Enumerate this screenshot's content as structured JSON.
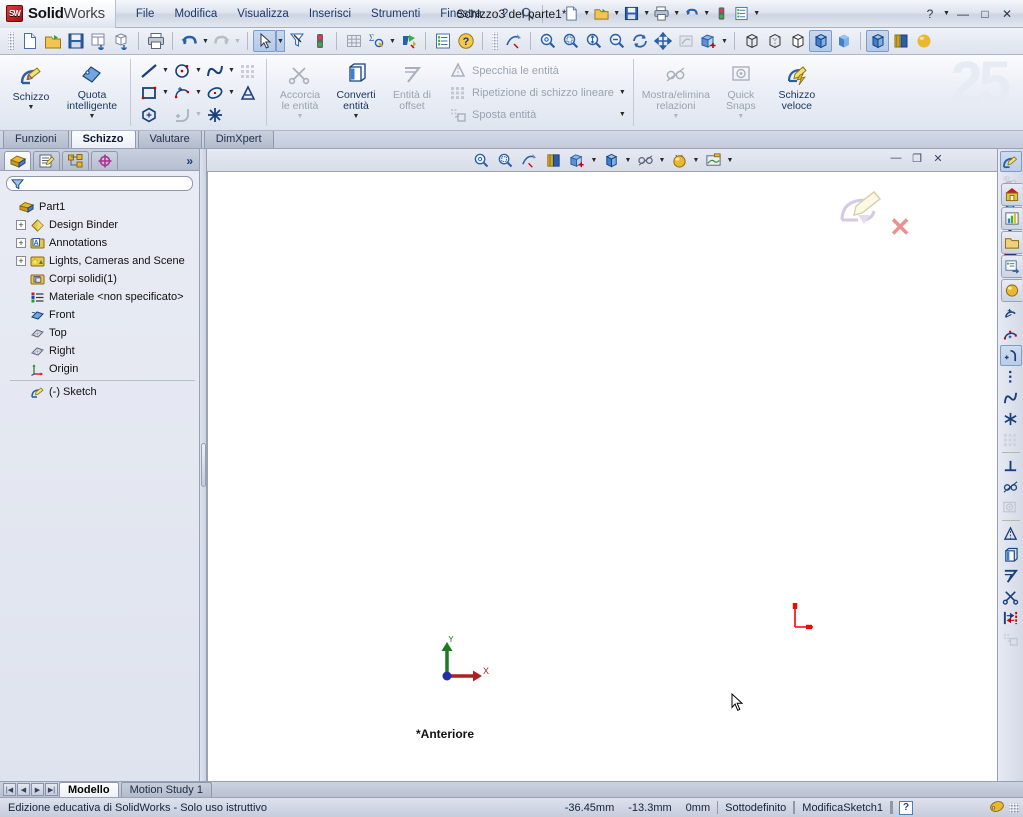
{
  "app": {
    "brand_bold": "Solid",
    "brand_light": "Works",
    "logo_text": "SW",
    "document_title": "Schizzo3 del parte1*"
  },
  "menu": {
    "items": [
      {
        "label": "File",
        "name": "menu-file"
      },
      {
        "label": "Modifica",
        "name": "menu-modifica"
      },
      {
        "label": "Visualizza",
        "name": "menu-visualizza"
      },
      {
        "label": "Inserisci",
        "name": "menu-inserisci"
      },
      {
        "label": "Strumenti",
        "name": "menu-strumenti"
      },
      {
        "label": "Finestra",
        "name": "menu-finestra"
      },
      {
        "label": "?",
        "name": "menu-help"
      }
    ]
  },
  "quick_access": {
    "icons": [
      "new-document-icon",
      "open-folder-icon",
      "save-icon",
      "print-icon",
      "undo-icon",
      "rebuild-icon",
      "options-icon"
    ]
  },
  "window_controls": {
    "help": "?",
    "minimize": "—",
    "maximize": "□",
    "close": "✕"
  },
  "standard_toolbar": {
    "icons": [
      "new-document-icon",
      "open-folder-icon",
      "save-icon",
      "save-all-icon",
      "pack-and-go-icon",
      "print-icon",
      "undo-icon",
      "redo-icon",
      "select-icon",
      "select-filter-icon",
      "rebuild-icon",
      "section-view-grid-icon",
      "measure-icon",
      "mass-properties-icon",
      "options-icon",
      "help-icon",
      "shaded-sketch-icon",
      "zoom-fit-icon",
      "zoom-area-icon",
      "zoom-in-out-icon",
      "zoom-selection-icon",
      "rotate-view-icon",
      "pan-icon",
      "3d-drawing-view-icon",
      "view-orientation-icon",
      "wireframe-icon",
      "hidden-lines-visible-icon",
      "hidden-lines-removed-icon",
      "shaded-with-edges-icon",
      "shaded-icon",
      "display-style-icon",
      "section-view-icon",
      "appearance-icon"
    ]
  },
  "ribbon": {
    "groups": [
      {
        "name": "sketch-group",
        "buttons": [
          {
            "label": "Schizzo",
            "icon": "sketch-pencil-icon",
            "disabled": false,
            "has_caret": true,
            "name": "ribbon-sketch-button"
          },
          {
            "label": "Quota\nintelligente",
            "label_line1": "Quota",
            "label_line2": "intelligente",
            "icon": "smart-dimension-icon",
            "disabled": false,
            "has_caret": true,
            "name": "ribbon-smart-dimension-button"
          }
        ]
      },
      {
        "name": "sketch-entities-group",
        "icons": [
          {
            "name": "line-icon",
            "caret": true,
            "pressed": false,
            "disabled": false
          },
          {
            "name": "circle-icon",
            "caret": true,
            "pressed": false,
            "disabled": false
          },
          {
            "name": "spline-icon",
            "caret": true,
            "pressed": false,
            "disabled": false
          },
          {
            "name": "sketch-pattern-icon",
            "caret": false,
            "pressed": false,
            "disabled": true
          },
          {
            "name": "rectangle-icon",
            "caret": true,
            "pressed": false,
            "disabled": false
          },
          {
            "name": "arc-3point-icon",
            "caret": true,
            "pressed": false,
            "disabled": false
          },
          {
            "name": "ellipse-icon",
            "caret": true,
            "pressed": false,
            "disabled": false
          },
          {
            "name": "text-icon",
            "caret": false,
            "pressed": false,
            "disabled": false
          },
          {
            "name": "polygon-icon",
            "caret": false,
            "pressed": false,
            "disabled": false
          },
          {
            "name": "fillet-icon",
            "caret": true,
            "pressed": false,
            "disabled": true
          },
          {
            "name": "point-icon",
            "caret": false,
            "pressed": false,
            "disabled": false
          }
        ]
      },
      {
        "name": "modify-group",
        "buttons": [
          {
            "label_line1": "Accorcia",
            "label_line2": "le entità",
            "icon": "trim-entities-icon",
            "disabled": true,
            "has_caret": true,
            "name": "ribbon-trim-entities-button"
          },
          {
            "label_line1": "Converti",
            "label_line2": "entità",
            "icon": "convert-entities-icon",
            "disabled": false,
            "has_caret": true,
            "name": "ribbon-convert-entities-button"
          },
          {
            "label_line1": "Entità di",
            "label_line2": "offset",
            "icon": "offset-entities-icon",
            "disabled": true,
            "has_caret": false,
            "name": "ribbon-offset-entities-button"
          }
        ]
      },
      {
        "name": "pattern-group",
        "rows": [
          {
            "label": "Specchia le entità",
            "icon": "mirror-entities-icon",
            "caret": false,
            "name": "ribbon-mirror-entities"
          },
          {
            "label": "Ripetizione di schizzo lineare",
            "icon": "linear-sketch-pattern-icon",
            "caret": true,
            "name": "ribbon-linear-sketch-pattern"
          },
          {
            "label": "Sposta entità",
            "icon": "move-entities-icon",
            "caret": true,
            "name": "ribbon-move-entities"
          }
        ]
      },
      {
        "name": "relations-group",
        "buttons": [
          {
            "label_line1": "Mostra/elimina",
            "label_line2": "relazioni",
            "icon": "display-delete-relations-icon",
            "disabled": true,
            "has_caret": true,
            "name": "ribbon-display-delete-relations-button"
          },
          {
            "label_line1": "Quick",
            "label_line2": "Snaps",
            "icon": "quick-snaps-icon",
            "disabled": true,
            "has_caret": true,
            "name": "ribbon-quick-snaps-button"
          },
          {
            "label_line1": "Schizzo",
            "label_line2": "veloce",
            "icon": "rapid-sketch-icon",
            "disabled": false,
            "has_caret": false,
            "name": "ribbon-rapid-sketch-button"
          }
        ]
      }
    ],
    "watermark": "25"
  },
  "command_tabs": [
    {
      "label": "Funzioni",
      "active": false,
      "name": "tab-funzioni"
    },
    {
      "label": "Schizzo",
      "active": true,
      "name": "tab-schizzo"
    },
    {
      "label": "Valutare",
      "active": false,
      "name": "tab-valutare"
    },
    {
      "label": "DimXpert",
      "active": false,
      "name": "tab-dimxpert"
    }
  ],
  "feature_manager": {
    "tabs": [
      {
        "icon": "feature-manager-tree-icon",
        "active": true,
        "name": "fm-tab-feature-tree"
      },
      {
        "icon": "property-manager-icon",
        "active": false,
        "name": "fm-tab-property-manager"
      },
      {
        "icon": "configuration-manager-icon",
        "active": false,
        "name": "fm-tab-configuration-manager"
      },
      {
        "icon": "dimxpert-manager-icon",
        "active": false,
        "name": "fm-tab-dimxpert-manager"
      }
    ],
    "more_label": "»",
    "filter_placeholder": "",
    "filter_icon": "filter-funnel-icon",
    "tree": [
      {
        "label": "Part1",
        "icon": "part-icon",
        "expandable": false,
        "level": 0,
        "name": "tree-node-part1"
      },
      {
        "label": "Design Binder",
        "icon": "design-binder-icon",
        "expandable": true,
        "level": 1,
        "name": "tree-node-design-binder"
      },
      {
        "label": "Annotations",
        "icon": "annotations-icon",
        "expandable": true,
        "level": 1,
        "name": "tree-node-annotations"
      },
      {
        "label": "Lights, Cameras and Scene",
        "icon": "lights-cameras-scene-icon",
        "expandable": true,
        "level": 1,
        "name": "tree-node-lights-cameras-scene"
      },
      {
        "label": "Corpi solidi(1)",
        "icon": "solid-bodies-icon",
        "expandable": false,
        "level": 1,
        "name": "tree-node-solid-bodies"
      },
      {
        "label": "Materiale <non specificato>",
        "icon": "material-icon",
        "expandable": false,
        "level": 1,
        "name": "tree-node-material"
      },
      {
        "label": "Front",
        "icon": "plane-front-icon",
        "expandable": false,
        "level": 1,
        "name": "tree-node-front-plane"
      },
      {
        "label": "Top",
        "icon": "plane-icon",
        "expandable": false,
        "level": 1,
        "name": "tree-node-top-plane"
      },
      {
        "label": "Right",
        "icon": "plane-icon",
        "expandable": false,
        "level": 1,
        "name": "tree-node-right-plane"
      },
      {
        "label": "Origin",
        "icon": "origin-icon",
        "expandable": false,
        "level": 1,
        "name": "tree-node-origin"
      },
      {
        "label": "(-) Sketch",
        "icon": "sketch-icon",
        "expandable": false,
        "level": 1,
        "name": "tree-node-sketch"
      }
    ]
  },
  "graphics_toolbar": {
    "icons": [
      "zoom-fit-icon",
      "zoom-area-icon",
      "previous-view-icon",
      "section-view-icon",
      "view-orientation-icon",
      "display-style-icon",
      "hide-show-items-icon",
      "appearance-icon",
      "scene-icon"
    ]
  },
  "graphics_window_controls": {
    "minimize": "—",
    "restore": "❐",
    "close": "✕"
  },
  "graphics": {
    "view_label": "*Anteriore",
    "triad_x": "X",
    "triad_y": "Y",
    "sketch_confirm_icon": "exit-sketch-icon",
    "sketch_cancel_icon": "cancel-sketch-icon",
    "origin_icon": "sketch-origin-icon",
    "cursor_icon": "mouse-pointer-icon"
  },
  "right_toolbar": {
    "icons": [
      {
        "name": "sketch-icon",
        "pressed": true,
        "disabled": false
      },
      {
        "name": "3d-sketch-icon",
        "pressed": false,
        "disabled": true
      },
      {
        "name": "smart-dimension-icon",
        "pressed": false,
        "disabled": false
      },
      {
        "name": "sep",
        "pressed": false,
        "disabled": false
      },
      {
        "name": "line-icon",
        "pressed": false,
        "disabled": false
      },
      {
        "name": "rectangle-icon",
        "pressed": false,
        "disabled": false
      },
      {
        "name": "circle-icon",
        "pressed": false,
        "disabled": false
      },
      {
        "name": "perimeter-circle-icon",
        "pressed": false,
        "disabled": false
      },
      {
        "name": "centerpoint-arc-icon",
        "pressed": false,
        "disabled": false
      },
      {
        "name": "3point-arc-icon",
        "pressed": false,
        "disabled": false
      },
      {
        "name": "tangent-arc-icon",
        "pressed": true,
        "disabled": false
      },
      {
        "name": "point-icon",
        "pressed": false,
        "disabled": false
      },
      {
        "name": "spline-icon",
        "pressed": false,
        "disabled": false
      },
      {
        "name": "centerline-star-icon",
        "pressed": false,
        "disabled": false
      },
      {
        "name": "sketch-pattern-icon",
        "pressed": false,
        "disabled": true
      },
      {
        "name": "sep",
        "pressed": false,
        "disabled": false
      },
      {
        "name": "add-relation-icon",
        "pressed": false,
        "disabled": false
      },
      {
        "name": "display-delete-relations-icon",
        "pressed": false,
        "disabled": false
      },
      {
        "name": "quick-snaps-icon",
        "pressed": false,
        "disabled": true
      },
      {
        "name": "sep",
        "pressed": false,
        "disabled": false
      },
      {
        "name": "mirror-entities-icon",
        "pressed": false,
        "disabled": false
      },
      {
        "name": "convert-entities-icon",
        "pressed": false,
        "disabled": false
      },
      {
        "name": "offset-entities-icon",
        "pressed": false,
        "disabled": false
      },
      {
        "name": "trim-entities-icon",
        "pressed": false,
        "disabled": false
      },
      {
        "name": "extend-entities-icon",
        "pressed": false,
        "disabled": false
      },
      {
        "name": "move-entities-icon",
        "pressed": false,
        "disabled": true
      }
    ]
  },
  "task_pane": {
    "buttons": [
      {
        "icon": "sw-resources-home-icon",
        "name": "task-pane-sw-resources"
      },
      {
        "icon": "design-library-chart-icon",
        "name": "task-pane-design-library"
      },
      {
        "icon": "file-explorer-folder-icon",
        "name": "task-pane-file-explorer"
      },
      {
        "icon": "search-properties-icon",
        "name": "task-pane-search"
      },
      {
        "icon": "appearances-sphere-icon",
        "name": "task-pane-appearances"
      }
    ]
  },
  "document_tabs": {
    "nav": [
      "first-icon",
      "prev-icon",
      "next-icon",
      "last-icon"
    ],
    "tabs": [
      {
        "label": "Modello",
        "active": true,
        "name": "doc-tab-modello"
      },
      {
        "label": "Motion Study 1",
        "active": false,
        "name": "doc-tab-motion-study-1"
      }
    ]
  },
  "status_bar": {
    "message": "Edizione educativa di SolidWorks - Solo uso istruttivo",
    "coord_x": "-36.45mm",
    "coord_y": "-13.3mm",
    "coord_z": "0mm",
    "sketch_state": "Sottodefinito",
    "edit_state": "ModificaSketch1",
    "help_badge": "?",
    "tag_icon": "tag-icon"
  },
  "colors": {
    "accent_blue": "#1b3a6b",
    "origin_red": "#ff0000",
    "axis_x": "#c00000",
    "axis_y": "#008000",
    "axis_z": "#0000c0",
    "titlebar": "#dfe4ee",
    "panel": "#e9ecf4",
    "canvas": "#ffffff"
  }
}
